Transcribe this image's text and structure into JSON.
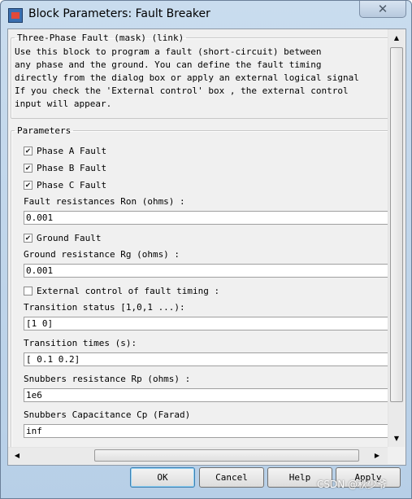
{
  "window": {
    "title": "Block Parameters: Fault Breaker",
    "close_glyph": "✕"
  },
  "mask": {
    "legend": "Three-Phase Fault (mask) (link)",
    "description": "Use this block to program a fault (short-circuit) between\nany phase and the ground. You can define the fault timing\ndirectly from the dialog box or apply an external logical signal\nIf you check the 'External control' box , the external control\ninput will appear."
  },
  "parameters": {
    "legend": "Parameters",
    "phase_a": {
      "label": "Phase A Fault",
      "checked": true
    },
    "phase_b": {
      "label": "Phase B Fault",
      "checked": true
    },
    "phase_c": {
      "label": "Phase C Fault",
      "checked": true
    },
    "fault_resistance": {
      "label": "Fault resistances  Ron (ohms) :",
      "value": "0.001"
    },
    "ground_fault": {
      "label": "Ground Fault",
      "checked": true
    },
    "ground_resistance": {
      "label": "Ground resistance Rg (ohms) :",
      "value": "0.001"
    },
    "external_control": {
      "label": "External control of fault timing :",
      "checked": false
    },
    "transition_status": {
      "label": "Transition status [1,0,1 ...):",
      "value": "[1 0]"
    },
    "transition_times": {
      "label": "Transition times (s):",
      "value": "[ 0.1 0.2]"
    },
    "snubber_resistance": {
      "label": "Snubbers resistance Rp (ohms) :",
      "value": "1e6"
    },
    "snubber_capacitance": {
      "label": "Snubbers Capacitance Cp (Farad)",
      "value": "inf"
    }
  },
  "buttons": {
    "ok": "OK",
    "cancel": "Cancel",
    "help": "Help",
    "apply": "Apply"
  },
  "scrollbar_glyphs": {
    "up": "▲",
    "down": "▼",
    "left": "◀",
    "right": "▶"
  },
  "watermark": "CSDN @秋少爷"
}
